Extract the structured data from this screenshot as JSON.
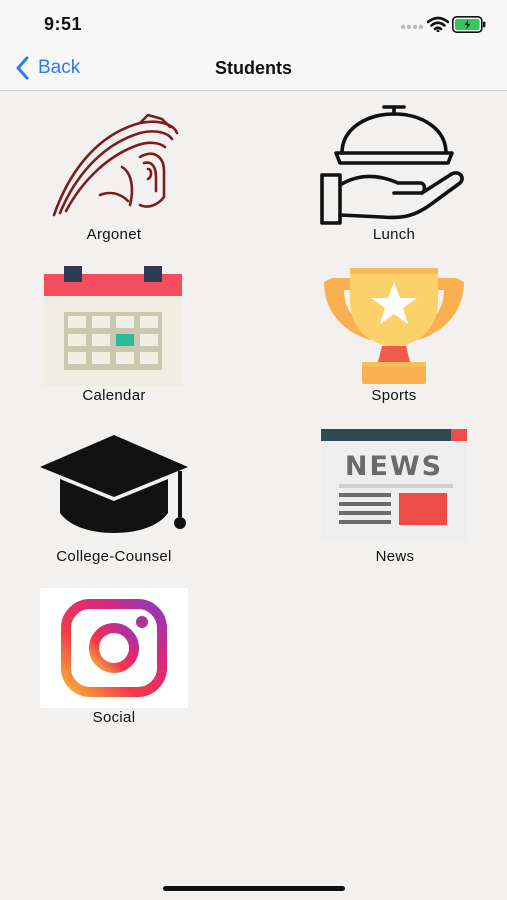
{
  "status": {
    "time": "9:51",
    "battery_color": "#34c759"
  },
  "nav": {
    "back_label": "Back",
    "title": "Students",
    "accent": "#2c7cf6"
  },
  "tiles": [
    {
      "label": "Argonet",
      "icon": "spartan-helmet-icon"
    },
    {
      "label": "Lunch",
      "icon": "serving-platter-icon"
    },
    {
      "label": "Calendar",
      "icon": "calendar-icon"
    },
    {
      "label": "Sports",
      "icon": "trophy-icon"
    },
    {
      "label": "College-Counsel",
      "icon": "graduation-cap-icon"
    },
    {
      "label": "News",
      "icon": "newspaper-icon"
    },
    {
      "label": "Social",
      "icon": "instagram-icon"
    }
  ],
  "news_icon_text": "NEWS"
}
